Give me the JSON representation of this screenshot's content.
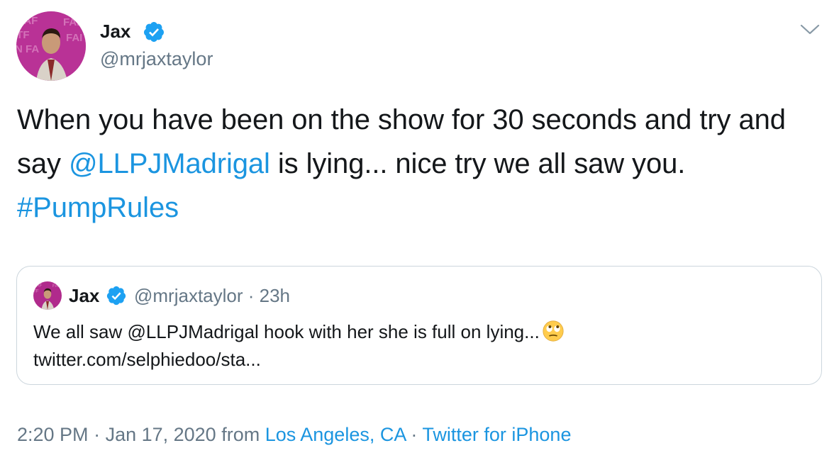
{
  "author": {
    "name": "Jax",
    "handle": "@mrjaxtaylor"
  },
  "icons": {
    "verified": "verified-badge-icon",
    "menu": "chevron-down-icon",
    "emoji": "face-with-rolling-eyes-emoji"
  },
  "tweet": {
    "text_1": "When you have been on the show for 30 seconds and try and say ",
    "mention": "@LLPJMadrigal",
    "text_2": " is lying... nice try we all saw you. ",
    "hashtag": "#PumpRules"
  },
  "quoted_tweet": {
    "name": "Jax",
    "handle": "@mrjaxtaylor",
    "separator": " · ",
    "time": "23h",
    "text_1": "We all saw ",
    "mention": "@LLPJMadrigal",
    "text_2": " hook with her she is full on lying...",
    "link": "twitter.com/selphiedoo/sta..."
  },
  "footer": {
    "time": "2:20 PM",
    "dot1": " · ",
    "date": "Jan 17, 2020",
    "from": " from ",
    "location": "Los Angeles, CA",
    "dot2": " · ",
    "source": "Twitter for iPhone"
  },
  "colors": {
    "link": "#1b95e0",
    "muted": "#657786",
    "text": "#14171a",
    "border": "#ccd6dd",
    "verified": "#1da1f2",
    "avatar_bg": "#b02a8c"
  }
}
